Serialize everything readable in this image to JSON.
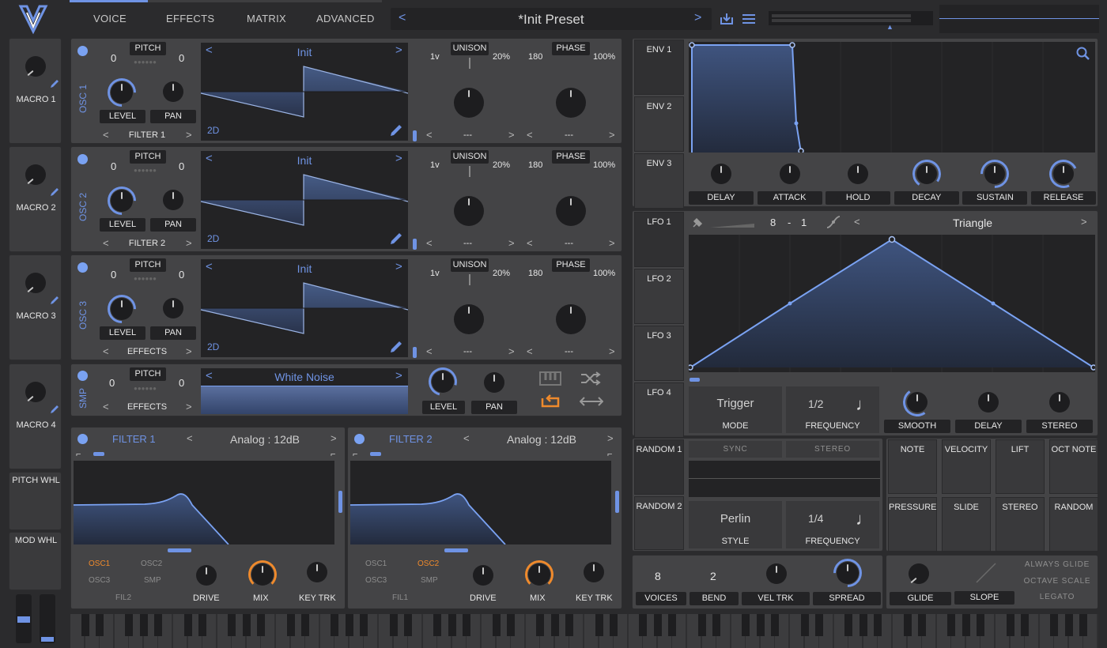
{
  "header": {
    "tabs": [
      "VOICE",
      "EFFECTS",
      "MATRIX",
      "ADVANCED"
    ],
    "preset_name": "*Init Preset",
    "prev_label": "<",
    "next_label": ">"
  },
  "macros": [
    "MACRO 1",
    "MACRO 2",
    "MACRO 3",
    "MACRO 4"
  ],
  "wheels": {
    "pitch": "PITCH WHL",
    "mod": "MOD WHL"
  },
  "oscillators": [
    {
      "label": "OSC 1",
      "pitch_title": "PITCH",
      "pitch_left": "0",
      "pitch_right": "0",
      "level": "LEVEL",
      "pan": "PAN",
      "route": "FILTER 1",
      "wavetable": "Init",
      "mode": "2D",
      "unison_title": "UNISON",
      "unison_voices": "1v",
      "unison_detune": "20%",
      "phase_title": "PHASE",
      "phase_val": "180",
      "phase_rand": "100%",
      "sel1": "---",
      "sel2": "---"
    },
    {
      "label": "OSC 2",
      "pitch_title": "PITCH",
      "pitch_left": "0",
      "pitch_right": "0",
      "level": "LEVEL",
      "pan": "PAN",
      "route": "FILTER 2",
      "wavetable": "Init",
      "mode": "2D",
      "unison_title": "UNISON",
      "unison_voices": "1v",
      "unison_detune": "20%",
      "phase_title": "PHASE",
      "phase_val": "180",
      "phase_rand": "100%",
      "sel1": "---",
      "sel2": "---"
    },
    {
      "label": "OSC 3",
      "pitch_title": "PITCH",
      "pitch_left": "0",
      "pitch_right": "0",
      "level": "LEVEL",
      "pan": "PAN",
      "route": "EFFECTS",
      "wavetable": "Init",
      "mode": "2D",
      "unison_title": "UNISON",
      "unison_voices": "1v",
      "unison_detune": "20%",
      "phase_title": "PHASE",
      "phase_val": "180",
      "phase_rand": "100%",
      "sel1": "---",
      "sel2": "---"
    }
  ],
  "sample": {
    "label": "SMP",
    "pitch_title": "PITCH",
    "pitch_left": "0",
    "pitch_right": "0",
    "route": "EFFECTS",
    "name": "White Noise",
    "level": "LEVEL",
    "pan": "PAN"
  },
  "filters": [
    {
      "title": "FILTER 1",
      "model": "Analog : 12dB",
      "src_a": "OSC1",
      "src_b": "OSC2",
      "src_c": "OSC3",
      "src_d": "SMP",
      "src_e": "FIL2",
      "drive": "DRIVE",
      "mix": "MIX",
      "keytrk": "KEY TRK"
    },
    {
      "title": "FILTER 2",
      "model": "Analog : 12dB",
      "src_a": "OSC1",
      "src_b": "OSC2",
      "src_c": "OSC3",
      "src_d": "SMP",
      "src_e": "FIL1",
      "drive": "DRIVE",
      "mix": "MIX",
      "keytrk": "KEY TRK"
    }
  ],
  "envelopes": {
    "tabs": [
      "ENV 1",
      "ENV 2",
      "ENV 3"
    ],
    "params": [
      "DELAY",
      "ATTACK",
      "HOLD",
      "DECAY",
      "SUSTAIN",
      "RELEASE"
    ]
  },
  "lfos": {
    "tabs": [
      "LFO 1",
      "LFO 2",
      "LFO 3",
      "LFO 4"
    ],
    "rate_a": "8",
    "rate_sep": "-",
    "rate_b": "1",
    "shape": "Triangle",
    "mode_value": "Trigger",
    "mode_label": "MODE",
    "freq_value": "1/2",
    "freq_label": "FREQUENCY",
    "params": [
      "SMOOTH",
      "DELAY",
      "STEREO"
    ]
  },
  "random": {
    "tabs": [
      "RANDOM 1",
      "RANDOM 2"
    ],
    "sync": "SYNC",
    "stereo": "STEREO",
    "style_value": "Perlin",
    "style_label": "STYLE",
    "freq_value": "1/4",
    "freq_label": "FREQUENCY"
  },
  "mod_sources": [
    "NOTE",
    "VELOCITY",
    "LIFT",
    "OCT NOTE",
    "PRESSURE",
    "SLIDE",
    "STEREO",
    "RANDOM"
  ],
  "voice": {
    "voices_value": "8",
    "voices_label": "VOICES",
    "bend_value": "2",
    "bend_label": "BEND",
    "veltrk": "VEL TRK",
    "spread": "SPREAD",
    "glide": "GLIDE",
    "slope": "SLOPE",
    "always_glide": "ALWAYS GLIDE",
    "octave_scale": "OCTAVE SCALE",
    "legato": "LEGATO"
  },
  "colors": {
    "accent": "#6f93e4",
    "orange": "#ef8a2c",
    "panel": "#414143",
    "background": "#2b2b2d"
  }
}
